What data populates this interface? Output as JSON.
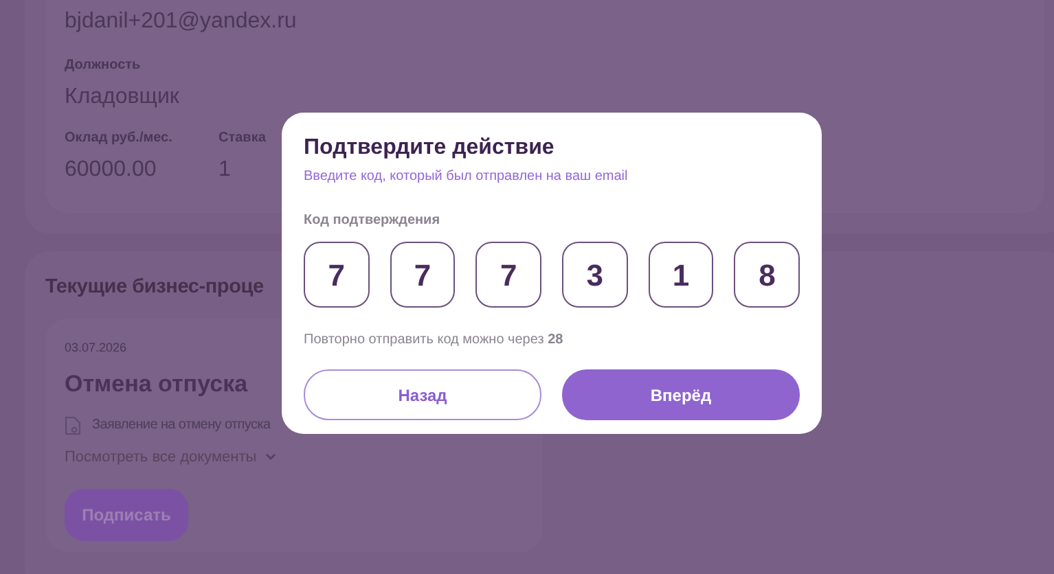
{
  "profile": {
    "email": "bjdanil+201@yandex.ru",
    "position": {
      "label": "Должность",
      "value": "Кладовщик"
    },
    "fields": [
      {
        "label": "Оклад руб./мес.",
        "value": "60000.00"
      },
      {
        "label": "Ставка",
        "value": "1"
      }
    ]
  },
  "processes": {
    "title": "Текущие бизнес-проце",
    "card": {
      "date": "03.07.2026",
      "title": "Отмена отпуска",
      "document": "Заявление на отмену отпуска",
      "view_all": "Посмотреть все документы",
      "sign_button": "Подписать"
    }
  },
  "dialog": {
    "title": "Подтвердите действие",
    "subtitle": "Введите код, который был отправлен на ваш email",
    "code_label": "Код подтверждения",
    "digits": [
      "7",
      "7",
      "7",
      "3",
      "1",
      "8"
    ],
    "resend": "Повторно отправить код можно через **28**",
    "back_button": "Назад",
    "next_button": "Вперёд"
  }
}
